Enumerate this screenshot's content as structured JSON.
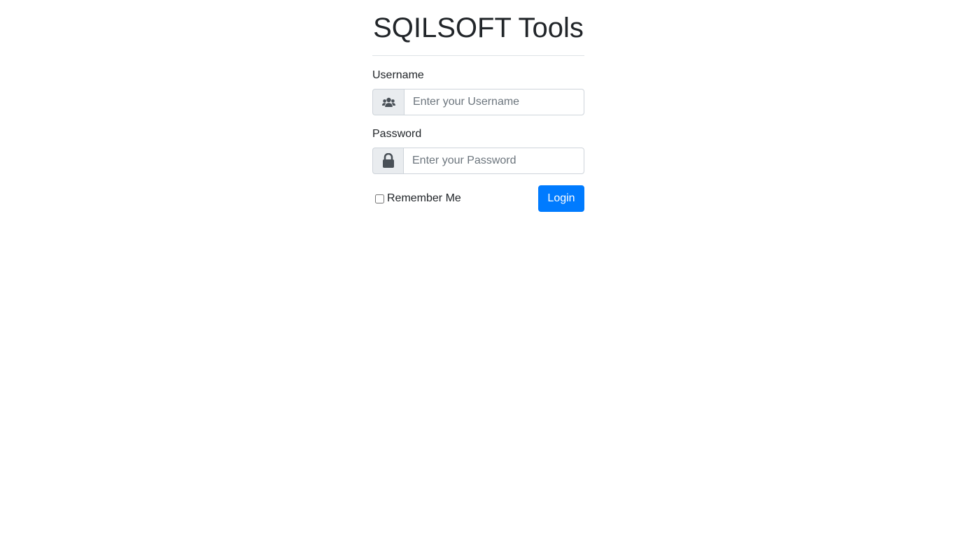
{
  "page": {
    "title": "SQILSOFT Tools"
  },
  "form": {
    "username": {
      "label": "Username",
      "placeholder": "Enter your Username",
      "value": "",
      "icon": "users-icon"
    },
    "password": {
      "label": "Password",
      "placeholder": "Enter your Password",
      "value": "",
      "icon": "lock-icon"
    },
    "remember_label": "Remember Me",
    "remember_checked": false,
    "login_label": "Login"
  },
  "colors": {
    "primary": "#007bff",
    "addon_bg": "#e9ecef",
    "border": "#ced4da",
    "text": "#212529"
  }
}
